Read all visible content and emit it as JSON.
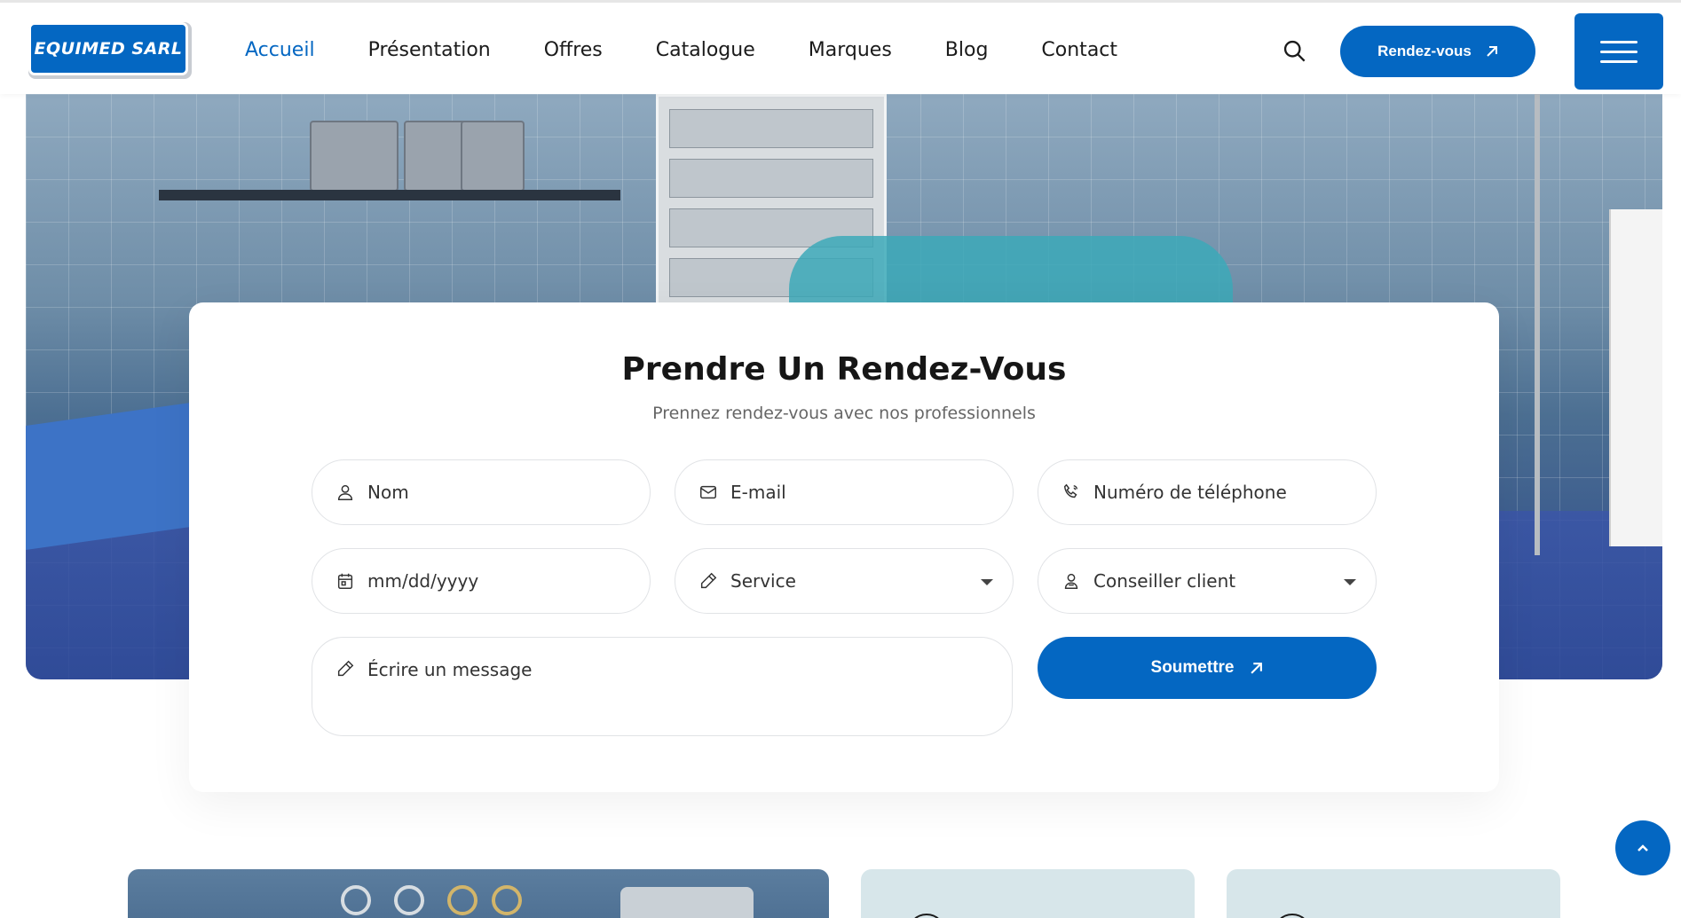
{
  "header": {
    "logo_text": "EQUIMED SARL",
    "nav": [
      {
        "label": "Accueil",
        "active": true
      },
      {
        "label": "Présentation",
        "active": false
      },
      {
        "label": "Offres",
        "active": false
      },
      {
        "label": "Catalogue",
        "active": false
      },
      {
        "label": "Marques",
        "active": false
      },
      {
        "label": "Blog",
        "active": false
      },
      {
        "label": "Contact",
        "active": false
      }
    ],
    "cta_label": "Rendez-vous",
    "icons": {
      "search": "search-icon",
      "menu": "hamburger-menu-icon",
      "cta_arrow": "arrow-up-right-icon"
    }
  },
  "appointment": {
    "title": "Prendre Un Rendez-Vous",
    "subtitle": "Prennez rendez-vous avec nos professionnels",
    "fields": {
      "name": {
        "placeholder": "Nom",
        "icon": "user-icon"
      },
      "email": {
        "placeholder": "E-mail",
        "icon": "envelope-icon"
      },
      "phone": {
        "placeholder": "Numéro de téléphone",
        "icon": "phone-icon"
      },
      "date": {
        "placeholder": "mm/dd/yyyy",
        "icon": "calendar-icon"
      },
      "service": {
        "selected": "Service",
        "icon": "pencil-icon"
      },
      "advisor": {
        "selected": "Conseiller client",
        "icon": "advisor-icon"
      },
      "message": {
        "placeholder": "Écrire un message",
        "icon": "pencil-icon"
      }
    },
    "submit_label": "Soumettre"
  },
  "colors": {
    "accent": "#0467c2",
    "text": "#1b1b1b",
    "muted": "#666666",
    "card_bg_light": "#d7e6ea"
  }
}
